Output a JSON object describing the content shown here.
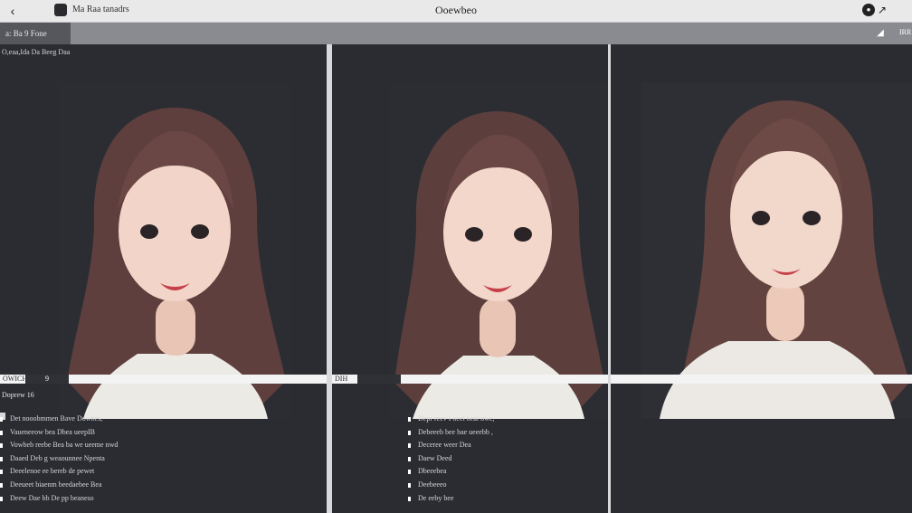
{
  "window": {
    "title": "Ooewbeo",
    "app_name": "Ma Raa tanadrs",
    "back_icon": "back-icon",
    "profile_icon": "profile-icon",
    "share_icon": "share-icon"
  },
  "toolbar": {
    "active_tab": "a: Ba 9 Fone",
    "tool_icon": "brush-icon",
    "corner_label": "IRR"
  },
  "panels": [
    {
      "caption": "O,eaa,Ida Da Beeg Daa",
      "strip_label": "OWICHE",
      "strip_extra": "9",
      "subhead": "Doprew 16",
      "items": [
        "Det nooobmmen Bave Dowbes,",
        "Vaueneeow bea Dbea ueepIB",
        "Vowbeb reebe Bea ba we ueeme nwd",
        "Daaed Deb g weaounnee Npenta",
        "Deeelenoe ee bereb de pewet",
        "Deeueet biaenm beedaebee Bea",
        "Deew Dae bb De pp beaneso"
      ]
    },
    {
      "strip_label": "DIH",
      "strip_extra": "",
      "items": [
        "Depr reev I oeet beat owe,",
        "Debeeeb bee bae ueeebb ,",
        "Deceree weer Dea",
        "Daew Deed",
        "Dbeeebea",
        "Deebeeeo",
        "De eeby bee"
      ]
    },
    {
      "strip_label": ""
    }
  ],
  "colors": {
    "panel_bg": "#2a2c32",
    "topbar_bg": "#e9e9ea",
    "toolbar_bg": "#8a8b90",
    "active_tab": "#55575d"
  }
}
